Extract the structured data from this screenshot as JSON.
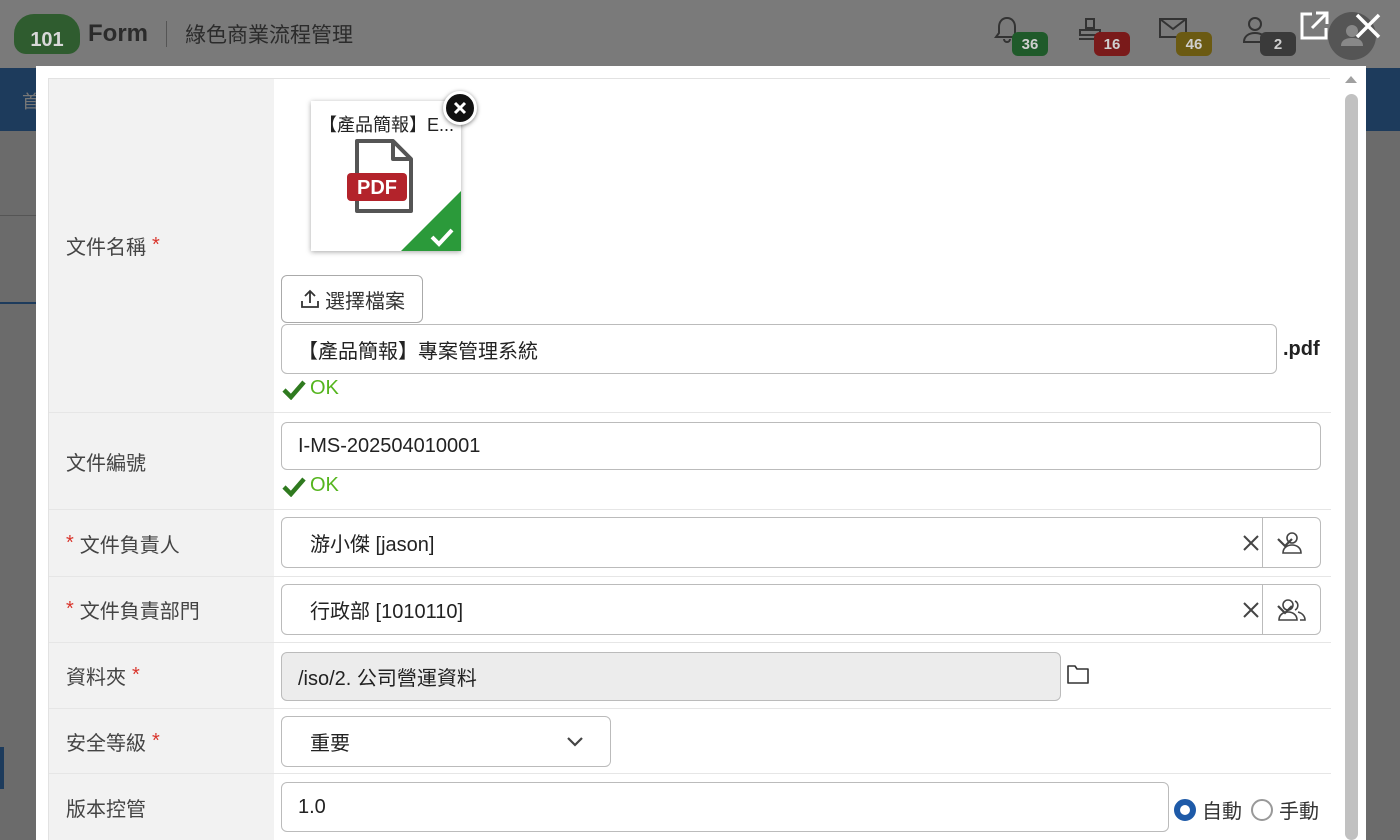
{
  "header": {
    "logo_number": "101",
    "logo_word": "Form",
    "app_subtitle": "綠色商業流程管理",
    "badges": [
      {
        "icon": "bell-icon",
        "count": "36",
        "color": "#1f5a2a"
      },
      {
        "icon": "stamp-icon",
        "count": "16",
        "color": "#7a1a1a"
      },
      {
        "icon": "mail-icon",
        "count": "46",
        "color": "#6b5a12"
      },
      {
        "icon": "user-icon",
        "count": "2",
        "color": "#3a3a3a"
      }
    ],
    "nav_first_char": "首"
  },
  "form": {
    "file_name": {
      "label": "文件名稱",
      "required_mark": "*",
      "thumb_title": "【產品簡報】E...",
      "thumb_type": "PDF",
      "choose_button": "選擇檔案",
      "value": "【產品簡報】專案管理系統",
      "extension": ".pdf",
      "status": "OK"
    },
    "doc_number": {
      "label": "文件編號",
      "value": "I-MS-202504010001",
      "status": "OK"
    },
    "owner": {
      "required_mark": "*",
      "label": "文件負責人",
      "value": "游小傑 [jason]"
    },
    "owner_dept": {
      "required_mark": "*",
      "label": "文件負責部門",
      "value": "行政部 [1010110]"
    },
    "folder": {
      "label": "資料夾",
      "required_mark": "*",
      "value": "/iso/2. 公司營運資料"
    },
    "security": {
      "label": "安全等級",
      "required_mark": "*",
      "value": "重要"
    },
    "version": {
      "label": "版本控管",
      "value": "1.0",
      "auto_label": "自動",
      "manual_label": "手動",
      "selected": "auto"
    }
  },
  "colors": {
    "required": "#d9342b",
    "ok": "#55b51e",
    "radio_selected": "#1e5aa8"
  }
}
